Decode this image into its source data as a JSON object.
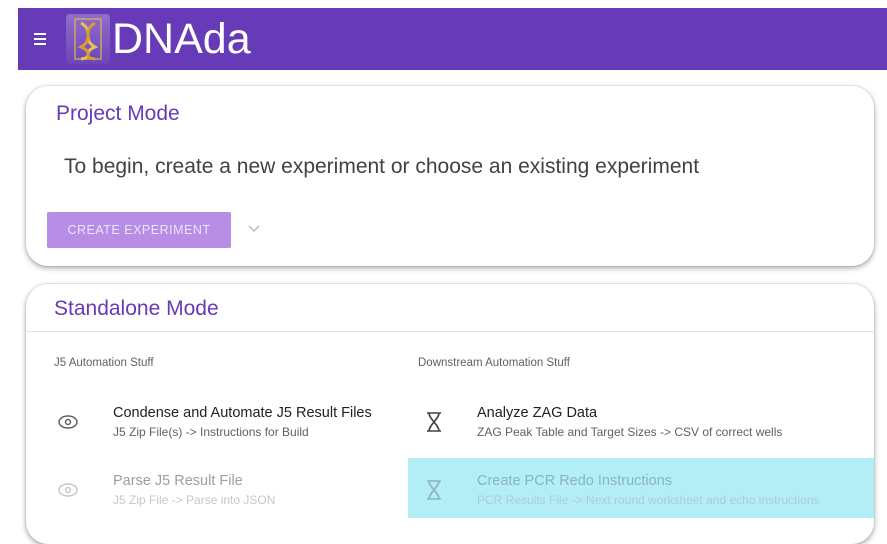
{
  "app": {
    "brand": "DNAda",
    "menu_icon": "hamburger-menu-icon",
    "logo_icon": "dna-logo-icon"
  },
  "project_mode": {
    "title": "Project Mode",
    "prompt": "To begin, create a new experiment or choose an existing experiment",
    "create_button_label": "CREATE EXPERIMENT",
    "dropdown_icon": "chevron-down-icon"
  },
  "standalone_mode": {
    "title": "Standalone Mode",
    "left_column": {
      "header": "J5 Automation Stuff",
      "items": [
        {
          "title": "Condense and Automate J5 Result Files",
          "subtitle": "J5 Zip File(s) -> Instructions for Build",
          "icon": "eye-icon",
          "state": "normal"
        },
        {
          "title": "Parse J5 Result File",
          "subtitle": "J5 Zip File -> Parse into JSON",
          "icon": "eye-icon",
          "state": "faded"
        }
      ]
    },
    "right_column": {
      "header": "Downstream Automation Stuff",
      "items": [
        {
          "title": "Analyze ZAG Data",
          "subtitle": "ZAG Peak Table and Target Sizes -> CSV of correct wells",
          "icon": "hourglass-dna-icon",
          "state": "normal"
        },
        {
          "title": "Create PCR Redo Instructions",
          "subtitle": "PCR Results File -> Next round worksheet and echo instructions",
          "icon": "hourglass-dna-icon",
          "state": "highlighted"
        }
      ]
    }
  },
  "colors": {
    "primary": "#673ab7",
    "button_bg": "#b88de5",
    "highlight": "#b3edf5"
  }
}
